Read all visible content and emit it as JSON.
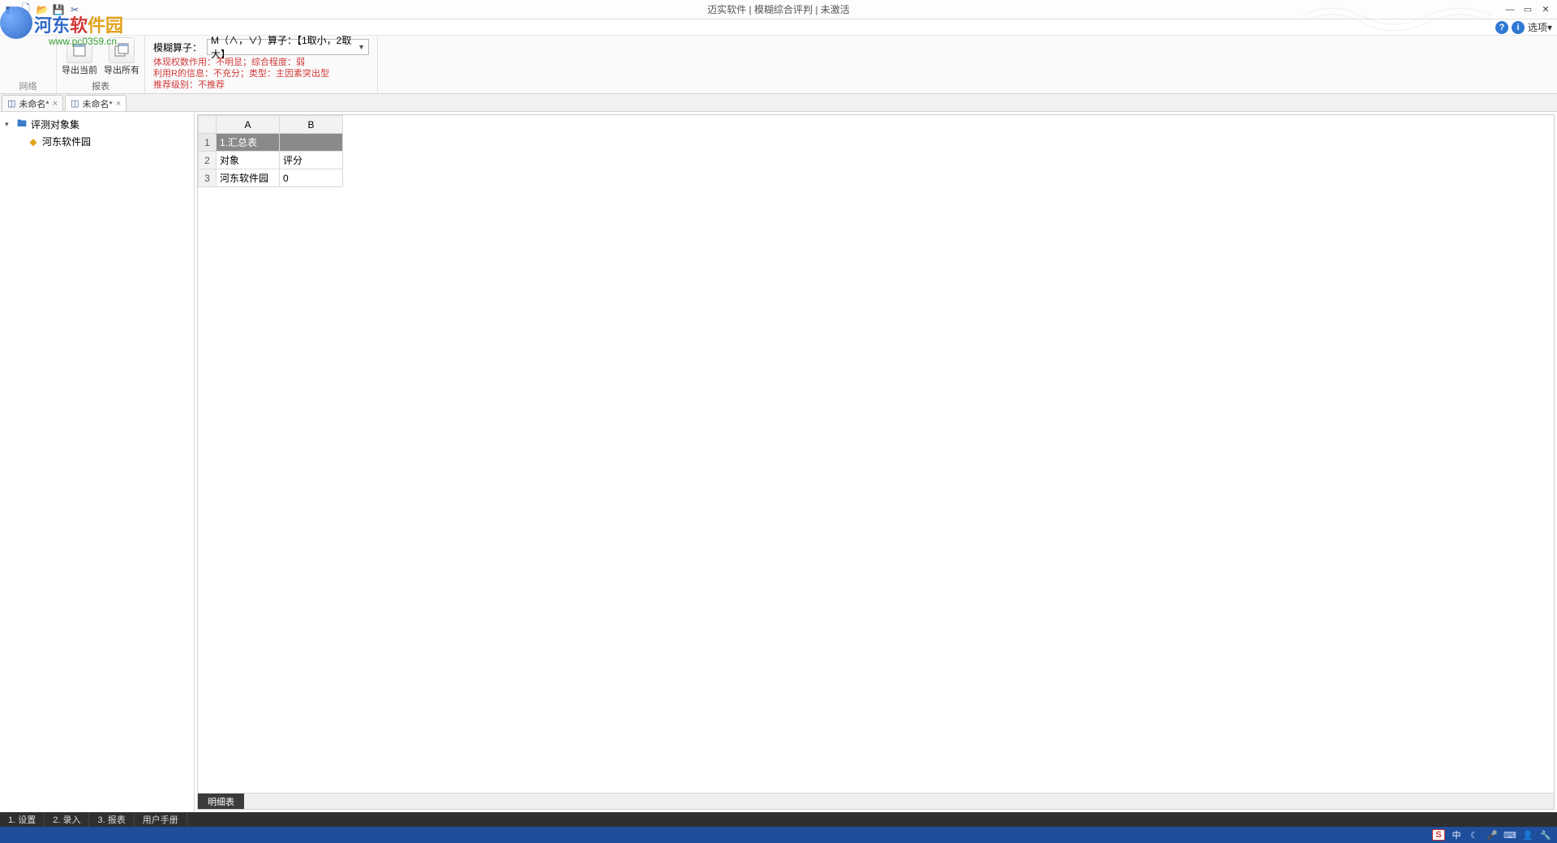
{
  "titlebar": {
    "title": "迈实软件 | 模糊综合评判 | 未激活",
    "icons": [
      "cube",
      "new",
      "open",
      "save",
      "cut"
    ]
  },
  "help": {
    "options_label": "选项▾"
  },
  "watermark": {
    "brand_a": "河东",
    "brand_b": "软",
    "brand_c": "件园",
    "url": "www.pc0359.cn"
  },
  "ribbon": {
    "network_label": "网络",
    "eval_label": "模糊综合评判",
    "reports": {
      "group_label": "报表",
      "export_current": "导出当前",
      "export_all": "导出所有"
    },
    "operator": {
      "label": "模糊算子：",
      "selected": "M（∧，∨）算子：【1取小，2取大】",
      "line1": "体现权数作用：不明显；综合程度：弱",
      "line2": "利用R的信息：不充分；类型：主因素突出型",
      "line3": "推荐级别：不推荐"
    }
  },
  "doctabs": [
    {
      "label": "未命名*",
      "active": false
    },
    {
      "label": "未命名*",
      "active": true
    }
  ],
  "tree": {
    "root": "评测对象集",
    "child": "河东软件园"
  },
  "grid": {
    "columns": [
      "A",
      "B"
    ],
    "rows": [
      {
        "n": "1",
        "a": "1.汇总表",
        "b": "",
        "selected": true
      },
      {
        "n": "2",
        "a": "对象",
        "b": "评分"
      },
      {
        "n": "3",
        "a": "河东软件园",
        "b": "0"
      }
    ]
  },
  "sheet_tab": "明细表",
  "bottomnav": [
    "1. 设置",
    "2. 录入",
    "3. 报表",
    "用户手册"
  ],
  "taskbar": {
    "ime_s": "S",
    "ime_lang": "中"
  }
}
